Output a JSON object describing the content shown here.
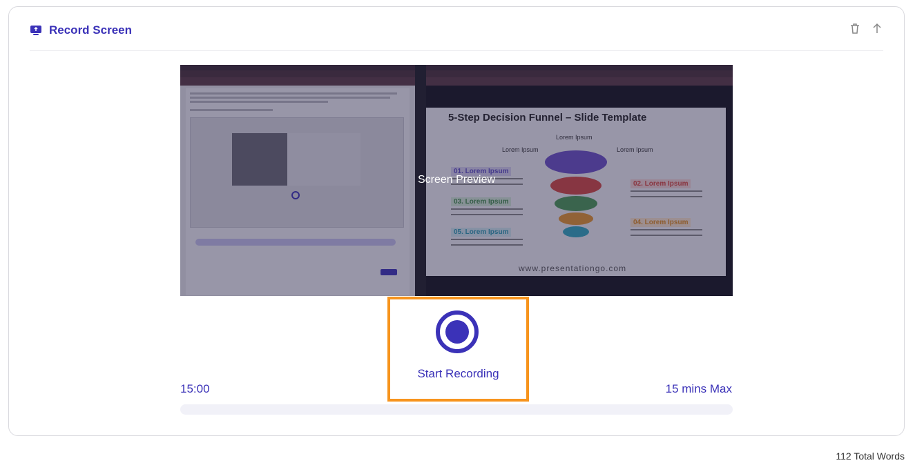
{
  "header": {
    "title": "Record Screen",
    "icon": "record-screen-icon"
  },
  "actions": {
    "delete_icon": "trash-icon",
    "move_up_icon": "arrow-up-icon"
  },
  "preview": {
    "label": "Screen Preview",
    "slide": {
      "title": "5-Step Decision Funnel – Slide Template",
      "top_label": "Lorem Ipsum",
      "left_label": "Lorem Ipsum",
      "right_label": "Lorem Ipsum",
      "cards": [
        "01. Lorem Ipsum",
        "02. Lorem Ipsum",
        "03. Lorem Ipsum",
        "04. Lorem Ipsum",
        "05. Lorem Ipsum"
      ],
      "steps": [
        "01",
        "02",
        "03",
        "04",
        "05"
      ],
      "site": "www.presentationgo.com"
    }
  },
  "record": {
    "label": "Start Recording"
  },
  "timer": "15:00",
  "max_label": "15 mins Max",
  "progress": 0,
  "footer": {
    "word_count": "112 Total Words"
  },
  "colors": {
    "accent": "#3b32b8",
    "highlight": "#f7941d"
  }
}
